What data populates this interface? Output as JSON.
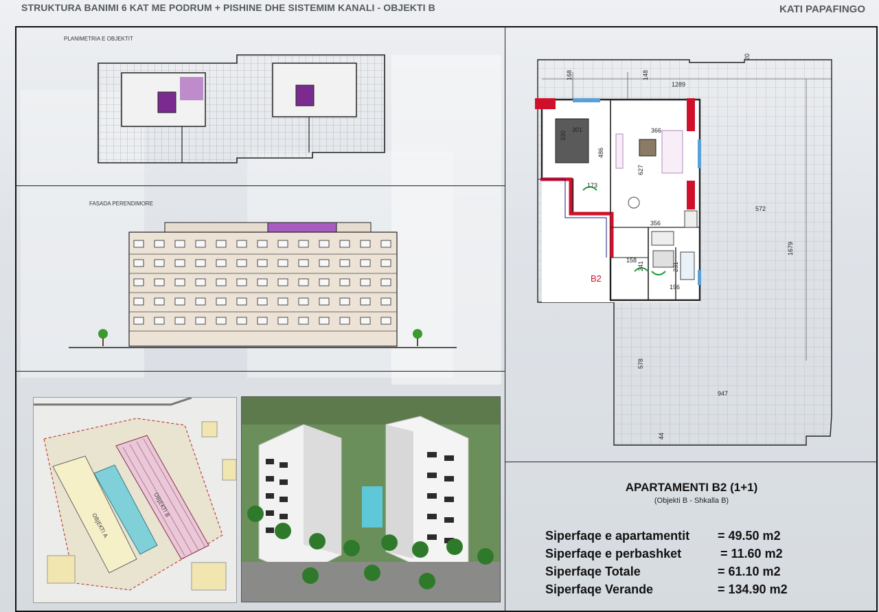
{
  "header": {
    "title": "STRUKTURA BANIMI 6 KAT ME PODRUM + PISHINE DHE SISTEMIM KANALI   -  OBJEKTI B",
    "floor": "KATI PAPAFINGO"
  },
  "sections": {
    "planimetry_label": "PLANIMETRIA E OBJEKTIT",
    "facade_label": "FASADA PERENDIMORE"
  },
  "floor_plan": {
    "unit_label": "B2",
    "dimensions": [
      "168",
      "148",
      "1289",
      "20",
      "301",
      "330",
      "366",
      "486",
      "627",
      "173",
      "572",
      "356",
      "158",
      "241",
      "231",
      "196",
      "1679",
      "578",
      "947",
      "44"
    ]
  },
  "apartment": {
    "title": "APARTAMENTI B2 (1+1)",
    "subtitle": "(Objekti B - Shkalla B)",
    "areas": [
      {
        "label": "Siperfaqe e apartamentit",
        "value": "= 49.50 m2"
      },
      {
        "label": "Siperfaqe e perbashket",
        "value": "= 11.60 m2"
      },
      {
        "label": "Siperfaqe Totale",
        "value": "= 61.10 m2"
      },
      {
        "label": "Siperfaqe Verande",
        "value": "= 134.90 m2"
      }
    ]
  },
  "site_plan": {
    "building_a": "OBJEKTI A",
    "building_b": "OBJEKTI B"
  }
}
